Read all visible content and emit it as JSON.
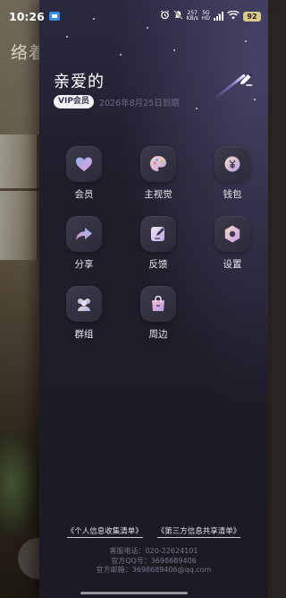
{
  "status_bar": {
    "time": "10:26",
    "net_speed_value": "257",
    "net_speed_unit": "KB/s",
    "network_type": "5G",
    "network_sub": "HD",
    "battery": "92"
  },
  "background": {
    "title": "络着"
  },
  "drawer": {
    "user_name": "亲爱的",
    "vip_badge": "VIP会员",
    "expire_text": "2026年8月25日到期",
    "menu": [
      {
        "label": "会员",
        "icon": "heart-icon"
      },
      {
        "label": "主视觉",
        "icon": "palette-icon"
      },
      {
        "label": "钱包",
        "icon": "wallet-icon"
      },
      {
        "label": "分享",
        "icon": "share-icon"
      },
      {
        "label": "反馈",
        "icon": "feedback-icon"
      },
      {
        "label": "设置",
        "icon": "settings-icon"
      },
      {
        "label": "群组",
        "icon": "group-icon"
      },
      {
        "label": "周边",
        "icon": "shopping-bag-icon"
      }
    ],
    "legal": {
      "privacy_list": "《个人信息收集清单》",
      "third_party_list": "《第三方信息共享清单》"
    },
    "contact": {
      "phone": "客服电话：020-22624101",
      "qq": "官方QQ号：3698689406",
      "email": "官方邮箱：3698689406@qq.com"
    }
  },
  "colors": {
    "drawer_bg": "#1d1c27",
    "accent_pink": "#e79bd8",
    "accent_blue": "#8fb4f0",
    "muted_text": "#6e6b80"
  }
}
